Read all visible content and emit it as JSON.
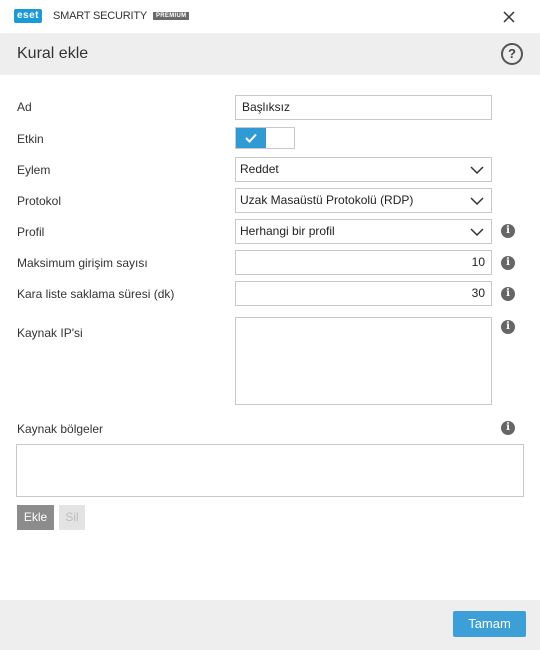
{
  "window": {
    "brand_logo": "eset",
    "product_name": "SMART SECURITY",
    "edition": "PREMIUM"
  },
  "header": {
    "title": "Kural ekle",
    "help_symbol": "?"
  },
  "form": {
    "name": {
      "label": "Ad",
      "value": "Başlıksız"
    },
    "enabled": {
      "label": "Etkin",
      "state": true
    },
    "action": {
      "label": "Eylem",
      "value": "Reddet"
    },
    "protocol": {
      "label": "Protokol",
      "value": "Uzak Masaüstü Protokolü (RDP)"
    },
    "profile": {
      "label": "Profil",
      "value": "Herhangi bir profil"
    },
    "max_attempts": {
      "label": "Maksimum girişim sayısı",
      "value": "10"
    },
    "blacklist_retention": {
      "label": "Kara liste saklama süresi (dk)",
      "value": "30"
    },
    "source_ip": {
      "label": "Kaynak IP'si",
      "value": ""
    },
    "source_zones": {
      "label": "Kaynak bölgeler"
    }
  },
  "buttons": {
    "add": "Ekle",
    "remove": "Sil",
    "ok": "Tamam"
  },
  "info_symbol": "i",
  "colors": {
    "accent": "#2f9ad3",
    "ok_button": "#3c9fd8",
    "header_bg": "#eeeeee"
  }
}
